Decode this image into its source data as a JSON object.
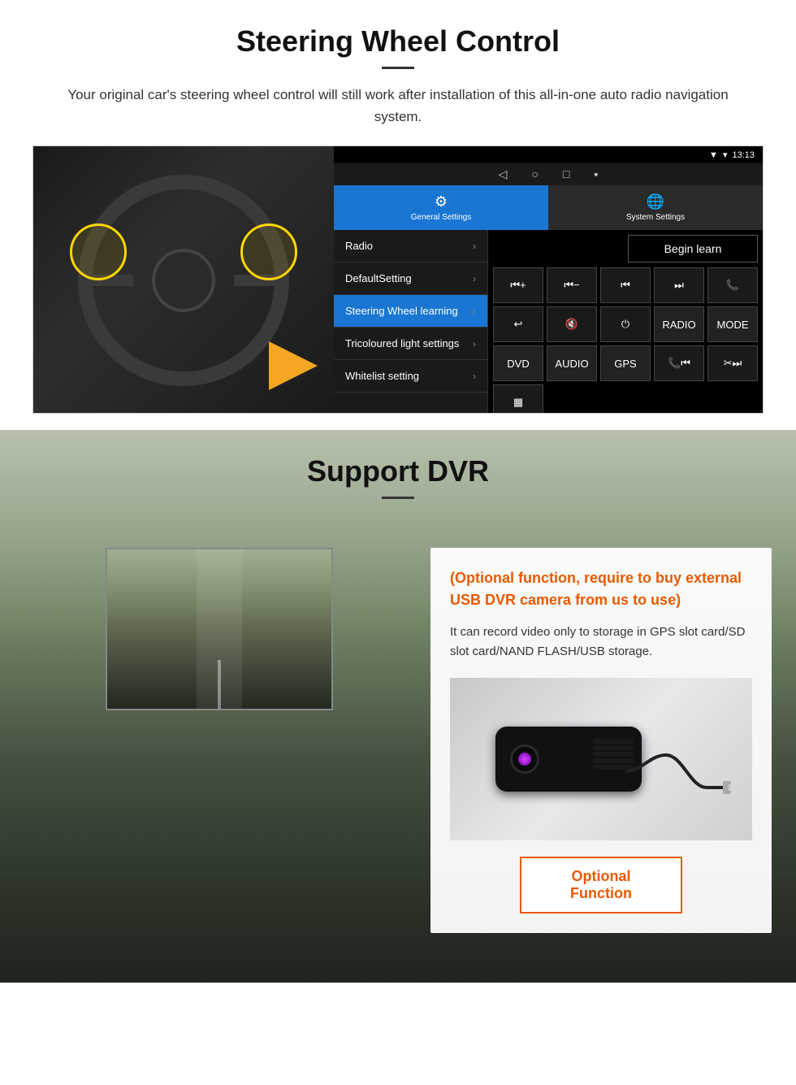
{
  "steering": {
    "title": "Steering Wheel Control",
    "subtitle": "Your original car's steering wheel control will still work after installation of this all-in-one auto radio navigation system.",
    "tabs": [
      {
        "label": "General Settings",
        "active": true
      },
      {
        "label": "System Settings",
        "active": false
      }
    ],
    "menu_items": [
      {
        "label": "Radio",
        "active": false
      },
      {
        "label": "DefaultSetting",
        "active": false
      },
      {
        "label": "Steering Wheel learning",
        "active": true
      },
      {
        "label": "Tricoloured light settings",
        "active": false
      },
      {
        "label": "Whitelist setting",
        "active": false
      }
    ],
    "begin_learn": "Begin learn",
    "controls": [
      "⏮+",
      "⏮−",
      "⏮⏮",
      "⏭⏭",
      "📞",
      "↩",
      "🔇",
      "⏻",
      "RADIO",
      "MODE",
      "DVD",
      "AUDIO",
      "GPS",
      "📞⏮",
      "✂⏭"
    ],
    "status_bar": {
      "time": "13:13",
      "signal": "▼"
    }
  },
  "dvr": {
    "title": "Support DVR",
    "optional_text": "(Optional function, require to buy external USB DVR camera from us to use)",
    "description": "It can record video only to storage in GPS slot card/SD slot card/NAND FLASH/USB storage.",
    "optional_button": "Optional Function"
  }
}
